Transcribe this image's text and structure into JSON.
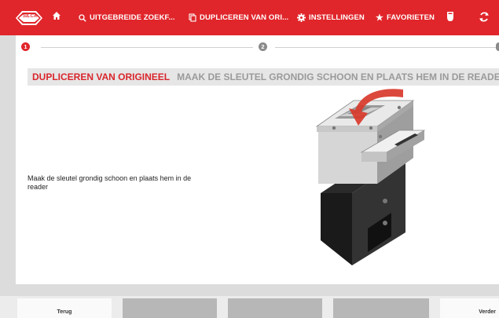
{
  "topbar": {
    "brand": "SILCA",
    "items": [
      {
        "label": "UITGEBREIDE ZOEKF...",
        "icon": "search-icon"
      },
      {
        "label": "DUPLICEREN VAN ORI...",
        "icon": "copy-icon"
      },
      {
        "label": "INSTELLINGEN",
        "icon": "gear-icon"
      },
      {
        "label": "FAVORIETEN",
        "icon": "star-icon"
      }
    ],
    "color": "#e0262b"
  },
  "stepper": {
    "steps": [
      {
        "number": "1",
        "state": "active"
      },
      {
        "number": "2",
        "state": "inactive"
      }
    ],
    "active_color": "#e0262b",
    "inactive_color": "#8a8a8a"
  },
  "content": {
    "title": "DUPLICEREN VAN ORIGINEEL",
    "subtitle": "MAAK DE SLEUTEL GRONDIG SCHOON EN PLAATS HEM IN DE READER",
    "instruction": "Maak de sleutel grondig schoon en plaats hem in de reader"
  },
  "footer": {
    "back_label": "Terug",
    "next_label": "Verder"
  }
}
